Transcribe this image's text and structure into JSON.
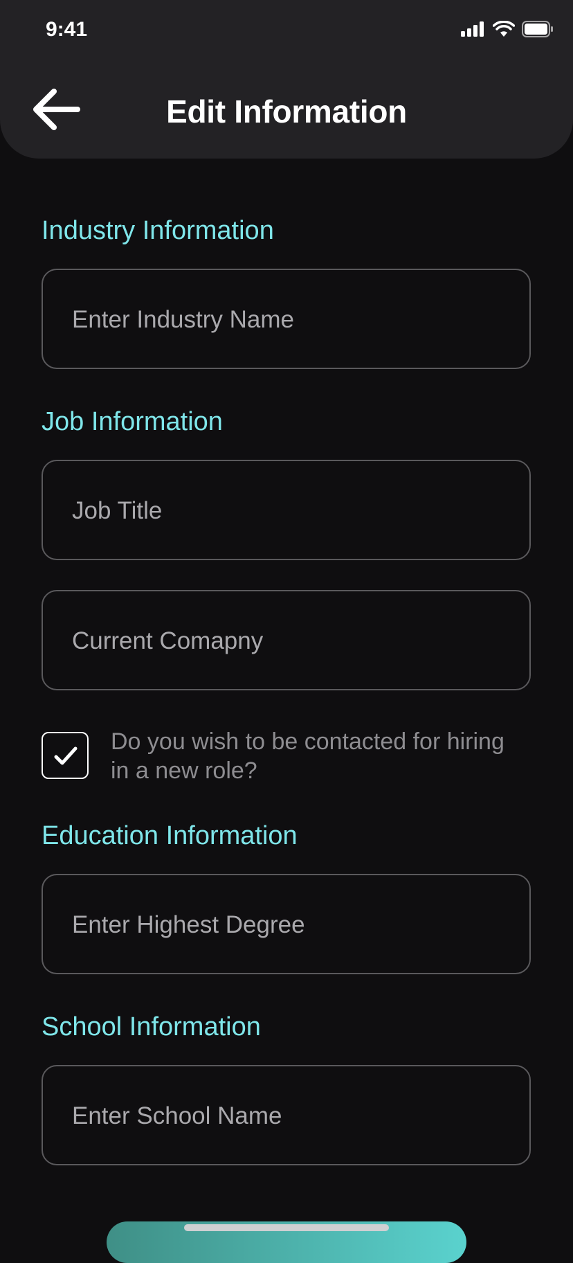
{
  "status_bar": {
    "time": "9:41"
  },
  "header": {
    "title": "Edit Information"
  },
  "sections": {
    "industry": {
      "label": "Industry Information",
      "placeholder": "Enter Industry Name"
    },
    "job": {
      "label": "Job Information",
      "job_title_placeholder": "Job Title",
      "company_placeholder": "Current Comapny",
      "contact_question": "Do you wish to be contacted for hiring in a new role?",
      "contact_checked": true
    },
    "education": {
      "label": "Education Information",
      "placeholder": "Enter Highest Degree"
    },
    "school": {
      "label": "School Information",
      "placeholder": "Enter School Name"
    }
  },
  "colors": {
    "accent": "#7fe6ea",
    "background": "#0f0e10",
    "header": "#232225"
  }
}
